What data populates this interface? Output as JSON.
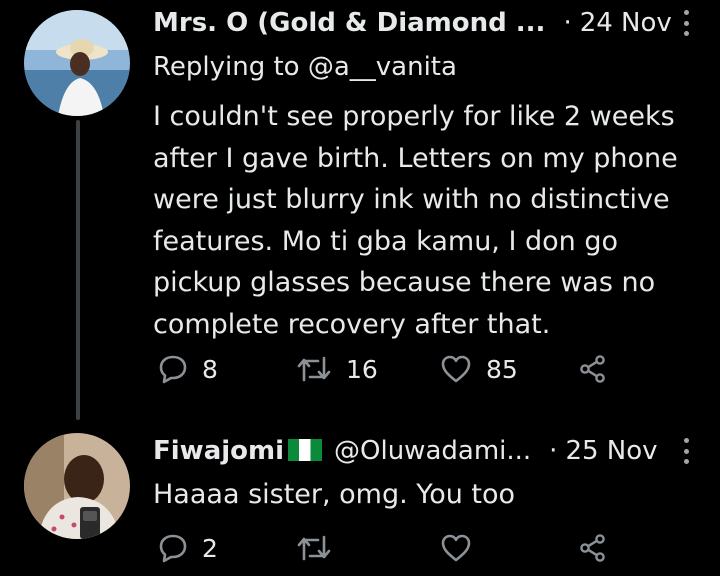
{
  "tweets": [
    {
      "author_name": "Mrs. O (Gold & Diamond ...",
      "handle": "",
      "separator": "·",
      "date": "24 Nov",
      "replying_to": "Replying to @a__vanita",
      "text": "I couldn't see properly for like 2 weeks after I gave birth. Letters on my phone were just blurry ink with no distinctive features. Mo ti gba kamu, I don go pickup glasses because there was no complete recovery after that.",
      "replies": "8",
      "retweets": "16",
      "likes": "85"
    },
    {
      "author_name": "Fiwajomi",
      "handle": "@Oluwadami...",
      "separator": "·",
      "date": "25 Nov",
      "text": "Haaaa sister, omg. You too",
      "replies": "2",
      "retweets": "",
      "likes": ""
    }
  ],
  "icons": {
    "reply": "reply-bubble-icon",
    "retweet": "retweet-arrows-icon",
    "like": "heart-icon",
    "share": "share-nodes-icon",
    "more": "vertical-dots-icon",
    "flag": "nigeria-flag-icon"
  },
  "colors": {
    "background": "#000000",
    "text": "#e7e9ea",
    "icon": "#8b9196",
    "thread_line": "#3e4144"
  }
}
